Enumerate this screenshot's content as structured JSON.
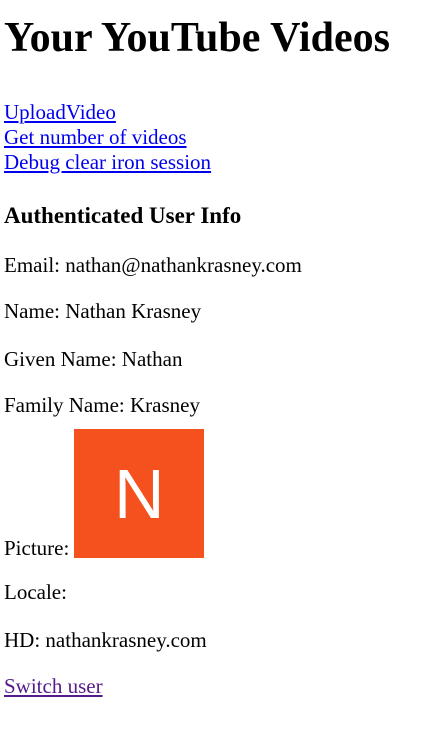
{
  "page": {
    "title": "Your YouTube Videos"
  },
  "links": {
    "upload_video": "UploadVideo",
    "get_number_of_videos": "Get number of videos",
    "debug_clear_iron_session": "Debug clear iron session"
  },
  "user_info": {
    "heading": "Authenticated User Info",
    "email_label": "Email:",
    "email_value": "nathan@nathankrasney.com",
    "name_label": "Name:",
    "name_value": "Nathan Krasney",
    "given_name_label": "Given Name:",
    "given_name_value": "Nathan",
    "family_name_label": "Family Name:",
    "family_name_value": "Krasney",
    "picture_label": "Picture:",
    "picture_letter": "N",
    "picture_color": "#f4511e",
    "locale_label": "Locale:",
    "locale_value": "",
    "hd_label": "HD:",
    "hd_value": "nathankrasney.com"
  },
  "actions": {
    "switch_user": "Switch user"
  },
  "colors": {
    "link": "#0000ee",
    "visited_link": "#551a8b"
  }
}
